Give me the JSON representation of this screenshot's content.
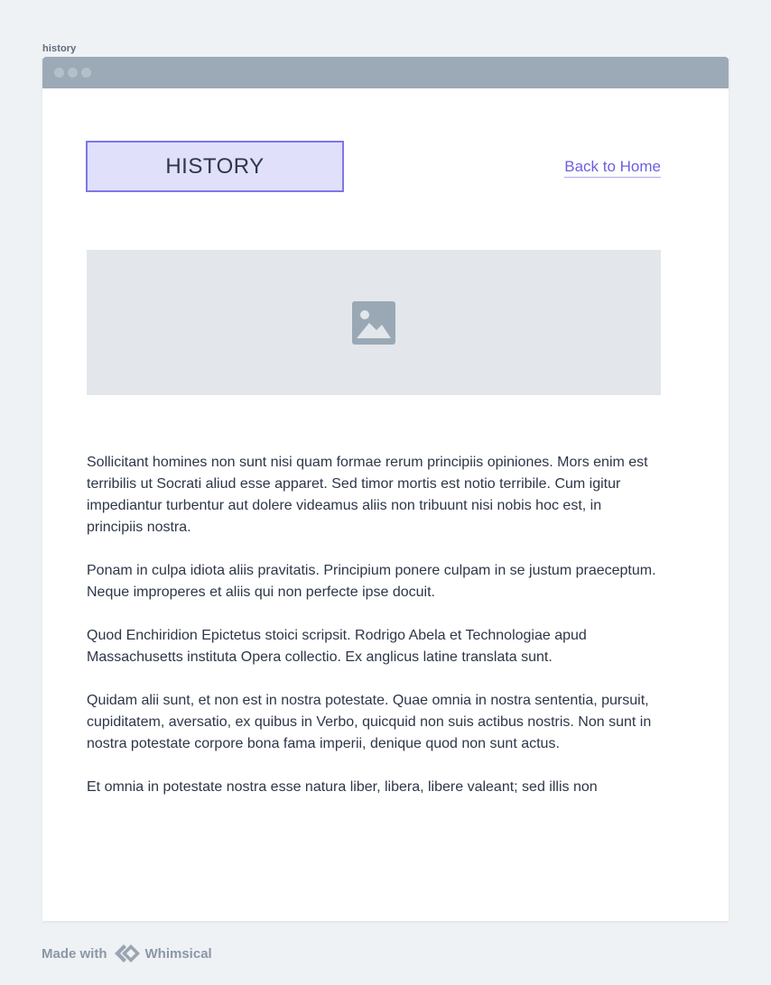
{
  "frame": {
    "label": "history"
  },
  "header": {
    "title": "HISTORY",
    "back_link": "Back to Home"
  },
  "image": {
    "icon": "image-placeholder-icon"
  },
  "content": {
    "paragraphs": [
      "Sollicitant homines non sunt nisi quam formae rerum principiis opiniones. Mors enim est terribilis ut Socrati aliud esse apparet. Sed timor mortis est notio terribile. Cum igitur impediantur turbentur aut dolere videamus aliis non tribuunt nisi nobis hoc est, in principiis nostra.",
      "Ponam in culpa idiota aliis pravitatis. Principium ponere culpam in se justum praeceptum. Neque improperes et aliis qui non perfecte ipse docuit.",
      "Quod Enchiridion Epictetus stoici scripsit. Rodrigo Abela et Technologiae apud Massachusetts instituta Opera collectio. Ex anglicus latine translata sunt.",
      "Quidam alii sunt, et non est in nostra potestate. Quae omnia in nostra sententia, pursuit, cupiditatem, aversatio, ex quibus in Verbo, quicquid non suis actibus nostris. Non sunt in nostra potestate corpore bona fama imperii, denique quod non sunt actus.",
      "Et omnia in potestate nostra esse natura liber, libera, libere valeant; sed illis non"
    ]
  },
  "footer": {
    "made_with": "Made with",
    "brand": "Whimsical"
  },
  "colors": {
    "accent": "#7e76ea",
    "link": "#6b5fe0",
    "title_bg": "#e0e0fb",
    "titlebar": "#9baab6",
    "placeholder": "#e3e7eb",
    "page_bg": "#eef2f5"
  }
}
